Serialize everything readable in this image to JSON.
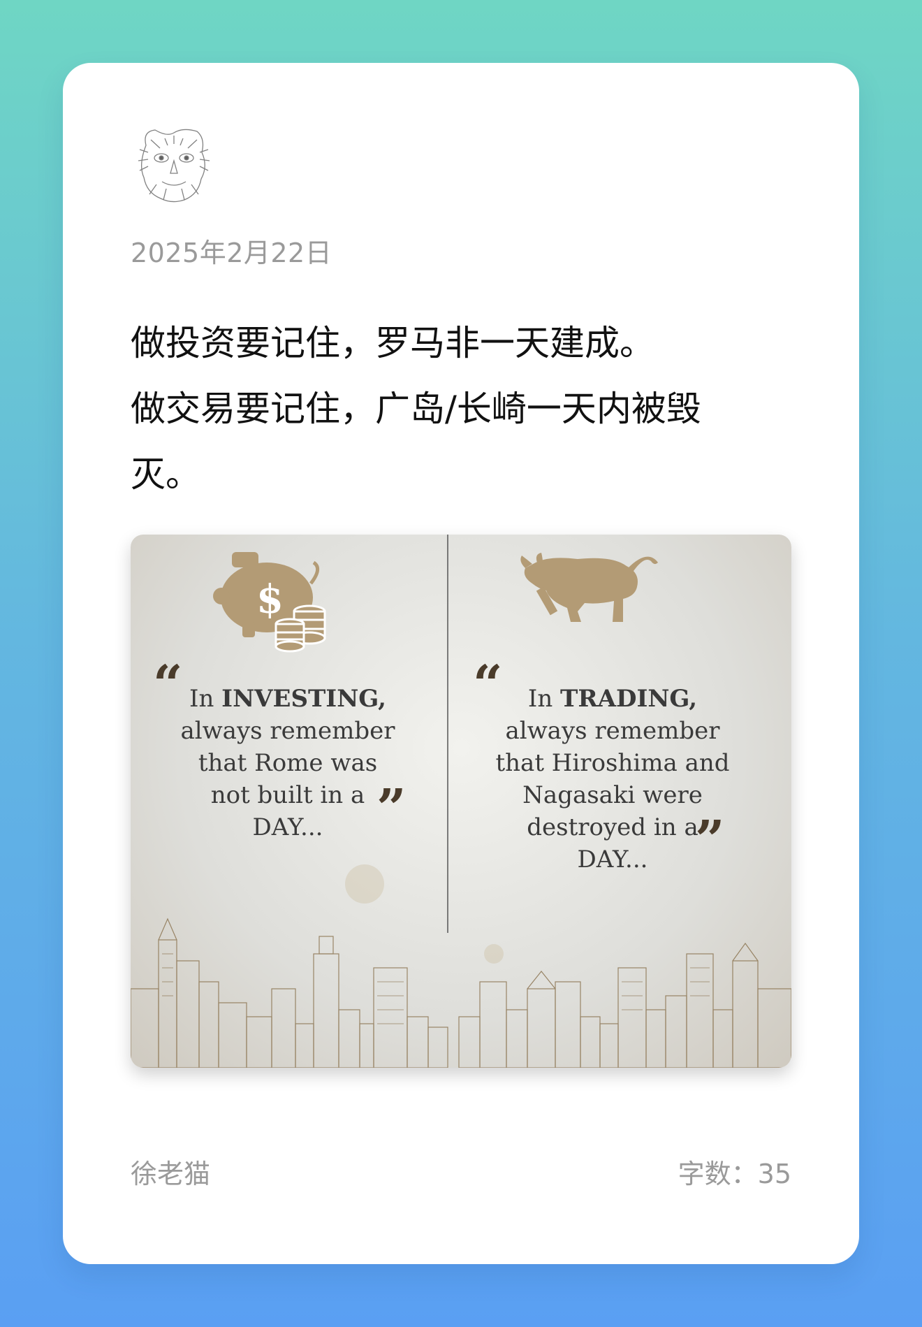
{
  "post": {
    "date": "2025年2月22日",
    "lines": [
      "做投资要记住，罗马非一天建成。",
      "做交易要记住，广岛/长崎一天内被毁灭。"
    ],
    "author": "徐老猫",
    "word_count": "字数：35"
  },
  "image": {
    "left_quote": {
      "line1_prefix": "In ",
      "line1_bold": "INVESTING,",
      "line2": "always remember",
      "line3": "that Rome was",
      "line4": "not built in a",
      "line5": "DAY..."
    },
    "right_quote": {
      "line1_prefix": "In ",
      "line1_bold": "TRADING,",
      "line2": "always remember",
      "line3": "that Hiroshima and",
      "line4": "Nagasaki were",
      "line5": "destroyed in a",
      "line6": "DAY..."
    },
    "open_quote_mark": "“",
    "close_quote_mark": "”"
  },
  "icons": {
    "avatar": "sketch-avatar-icon",
    "piggy_bank": "piggy-bank-icon",
    "bull": "bull-icon",
    "skyline": "city-skyline-illustration"
  },
  "colors": {
    "background_top": "#6fd6c4",
    "background_bottom": "#5a9ff3",
    "card": "#ffffff",
    "muted_text": "#9a9a9a",
    "body_text": "#111111",
    "illustration_accent": "#b39b75"
  }
}
